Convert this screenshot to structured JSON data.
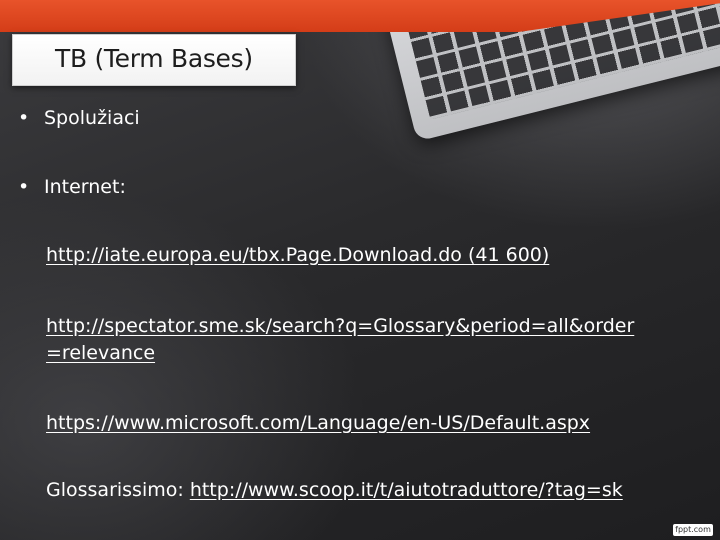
{
  "slide": {
    "title": "TB (Term Bases)",
    "bullets": [
      {
        "marker": "•",
        "text": "Spolužiaci"
      },
      {
        "marker": "•",
        "text": "Internet:"
      }
    ],
    "links": [
      {
        "text": "http://iate.europa.eu/tbx.Page.Download.do   (41 600)"
      },
      {
        "line1": "http://spectator.sme.sk/search?q=Glossary&period=all&order",
        "line2": "=relevance"
      },
      {
        "text": "https://www.microsoft.com/Language/en-US/Default.aspx"
      },
      {
        "prefix": "Glossarissimo: ",
        "url": "http://www.scoop.it/t/aiutotraduttore/?tag=sk"
      }
    ],
    "watermark": "fppt.com"
  },
  "colors": {
    "accent": "#d43d18",
    "text": "#ffffff",
    "background": "#2f2f31"
  }
}
